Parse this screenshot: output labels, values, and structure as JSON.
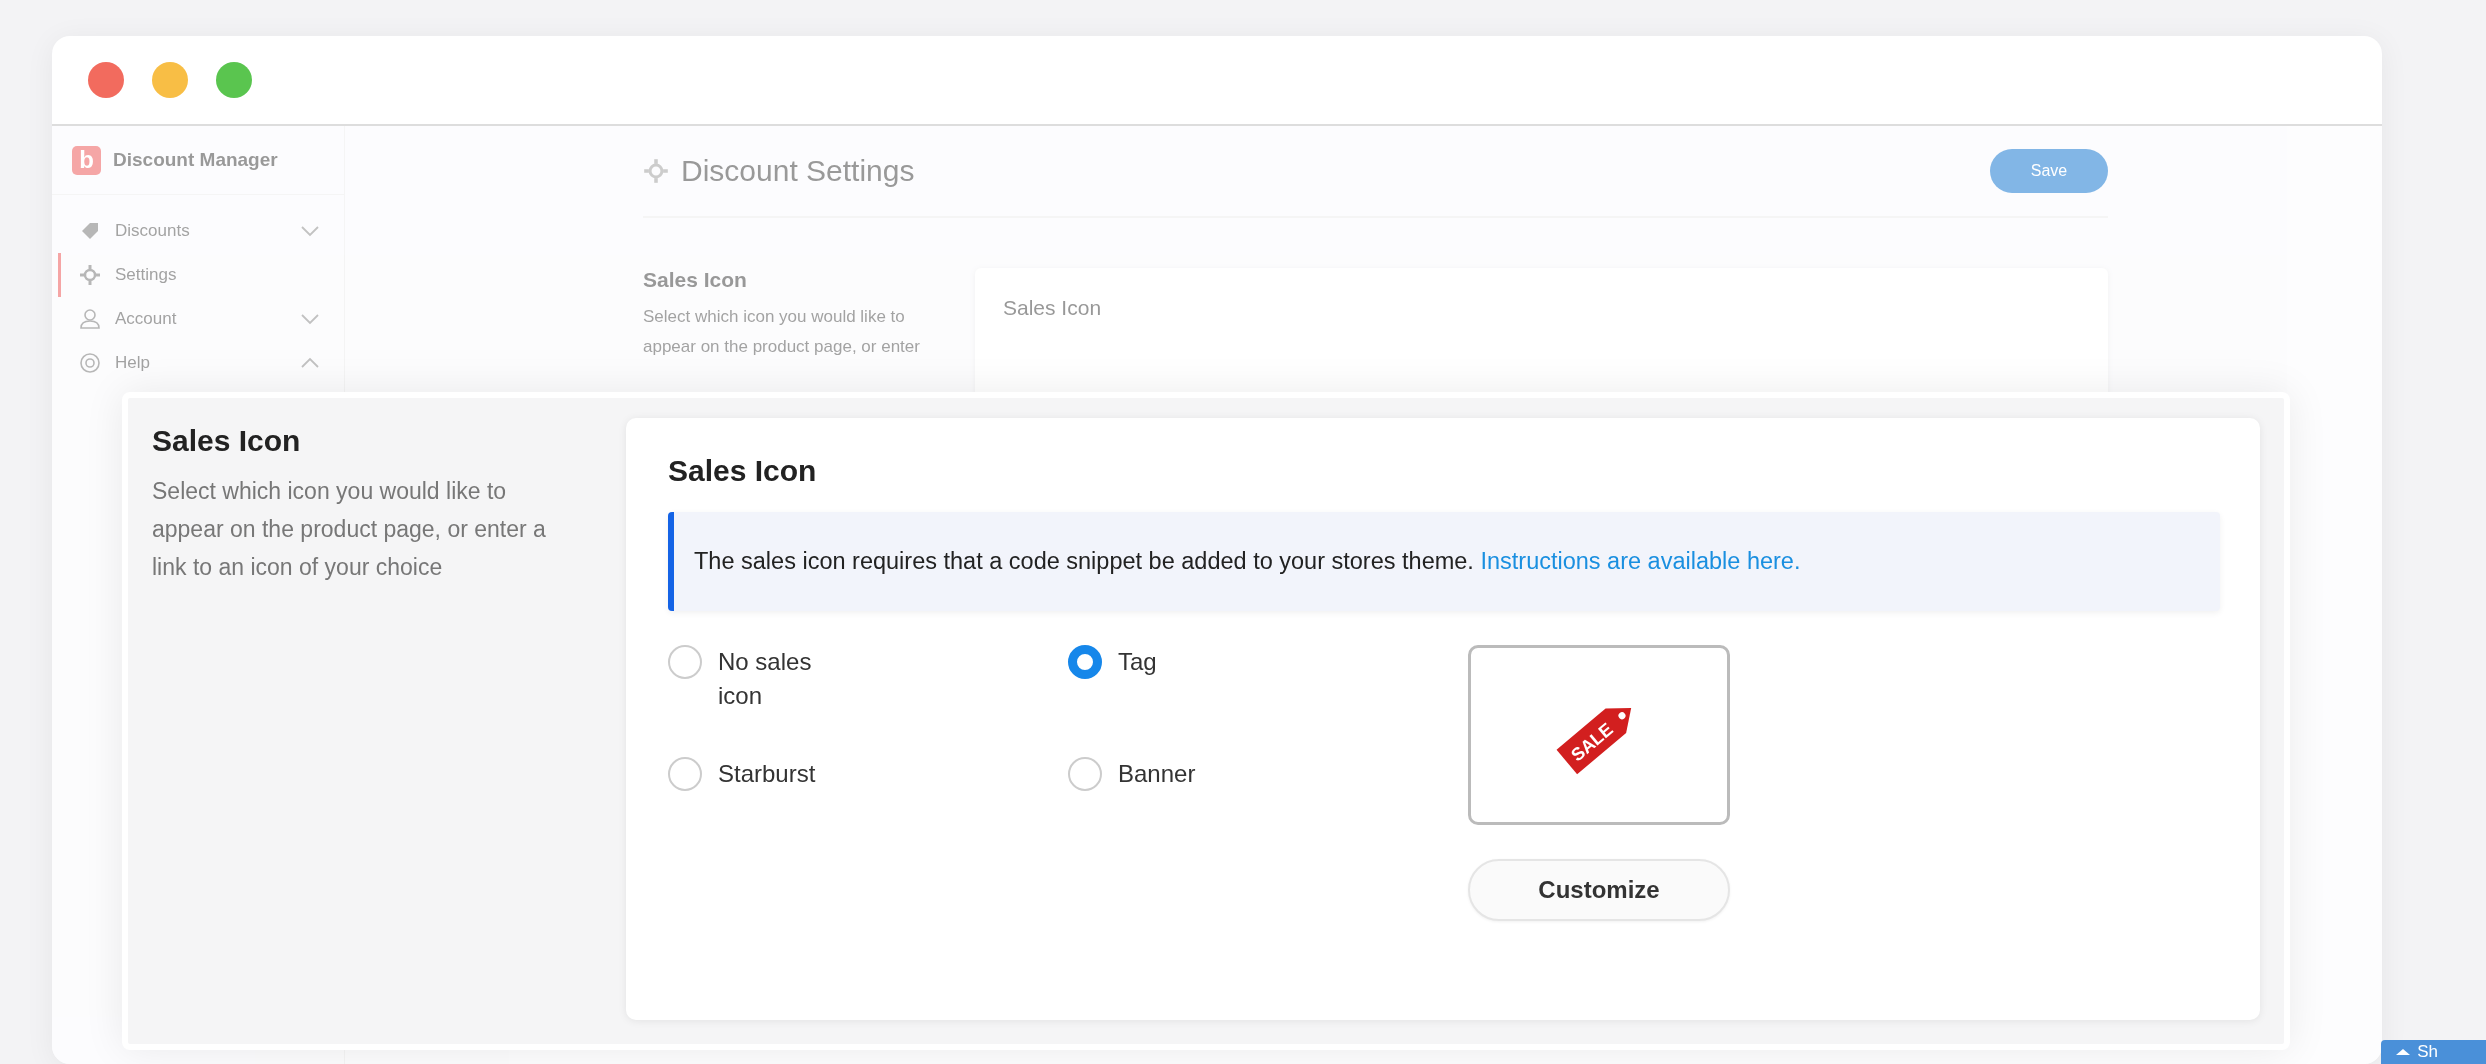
{
  "app": {
    "logo_letter": "b",
    "name": "Discount Manager"
  },
  "sidebar": {
    "items": [
      {
        "label": "Discounts",
        "kind": "group",
        "expanded": false,
        "selected": false
      },
      {
        "label": "Settings",
        "kind": "link",
        "selected": true
      },
      {
        "label": "Account",
        "kind": "group",
        "expanded": false,
        "selected": false
      },
      {
        "label": "Help",
        "kind": "group",
        "expanded": true,
        "selected": false
      }
    ]
  },
  "page": {
    "title": "Discount Settings",
    "save_button": "Save",
    "section_title": "Sales Icon",
    "section_description": "Select which icon you would like to appear on the product page, or enter",
    "card_title": "Sales Icon"
  },
  "zoomed_panel": {
    "section_title": "Sales Icon",
    "section_description": "Select which icon you would like to appear on the product page, or enter a link to an icon of your choice",
    "card_title": "Sales Icon",
    "notice": {
      "text": "The sales icon requires that a code snippet be added to your stores theme.",
      "link": "Instructions are available here."
    },
    "options": [
      {
        "label": "No sales icon",
        "selected": false
      },
      {
        "label": "Tag",
        "selected": true
      },
      {
        "label": "Starburst",
        "selected": false
      },
      {
        "label": "Banner",
        "selected": false
      }
    ],
    "preview": {
      "tag_text": "SALE"
    },
    "customize_button": "Customize"
  },
  "corner_button": {
    "label": "Sh"
  }
}
